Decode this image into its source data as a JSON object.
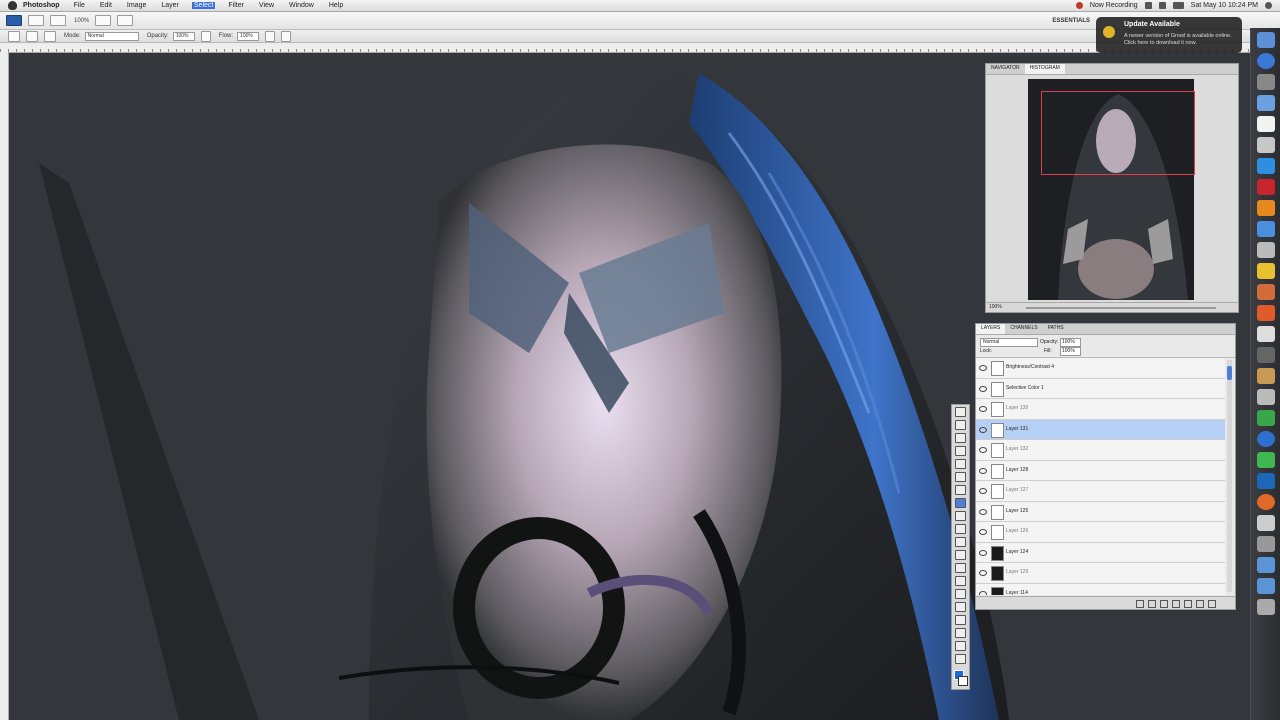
{
  "menubar": {
    "app_name": "Photoshop",
    "items": [
      "File",
      "Edit",
      "Image",
      "Layer",
      "Select",
      "Filter",
      "View",
      "Window",
      "Help"
    ],
    "selected_item": "Select",
    "recording": "Now Recording",
    "clock": "Sat May 10  10:24 PM"
  },
  "appbar": {
    "zoom": "100%",
    "workspace": "ESSENTIALS"
  },
  "options_bar": {
    "mode_label": "Mode:",
    "mode_value": "Normal",
    "opacity_label": "Opacity:",
    "opacity_value": "100%",
    "flow_label": "Flow:",
    "flow_value": "100%"
  },
  "update_popup": {
    "title": "Update Available",
    "message": "A newer version of Growl is available online. Click here to download it now."
  },
  "navigator": {
    "tabs": [
      "NAVIGATOR",
      "HISTOGRAM"
    ],
    "active_tab": "HISTOGRAM",
    "zoom": "100%"
  },
  "layers": {
    "tabs": [
      "LAYERS",
      "CHANNELS",
      "PATHS"
    ],
    "blend_mode": "Normal",
    "opacity_label": "Opacity:",
    "opacity_value": "100%",
    "lock_label": "Lock:",
    "fill_label": "Fill:",
    "fill_value": "100%",
    "rows": [
      {
        "name": "Brightness/Contrast 4",
        "selected": false,
        "sub": false,
        "dark": false
      },
      {
        "name": "Selective Color 1",
        "selected": false,
        "sub": false,
        "dark": false
      },
      {
        "name": "Layer 130",
        "selected": false,
        "sub": true,
        "dark": false
      },
      {
        "name": "Layer 131",
        "selected": true,
        "sub": false,
        "dark": false
      },
      {
        "name": "Layer 132",
        "selected": false,
        "sub": true,
        "dark": false
      },
      {
        "name": "Layer 128",
        "selected": false,
        "sub": false,
        "dark": false
      },
      {
        "name": "Layer 127",
        "selected": false,
        "sub": true,
        "dark": false
      },
      {
        "name": "Layer 125",
        "selected": false,
        "sub": false,
        "dark": false
      },
      {
        "name": "Layer 126",
        "selected": false,
        "sub": true,
        "dark": false
      },
      {
        "name": "Layer 124",
        "selected": false,
        "sub": false,
        "dark": true
      },
      {
        "name": "Layer 129",
        "selected": false,
        "sub": true,
        "dark": true
      },
      {
        "name": "Layer 114",
        "selected": false,
        "sub": false,
        "dark": true
      }
    ]
  },
  "colors": {
    "foreground": "#1a6ad8",
    "background": "#ffffff",
    "selection": "#b6d0f5",
    "proxy_box": "#e13b52"
  }
}
